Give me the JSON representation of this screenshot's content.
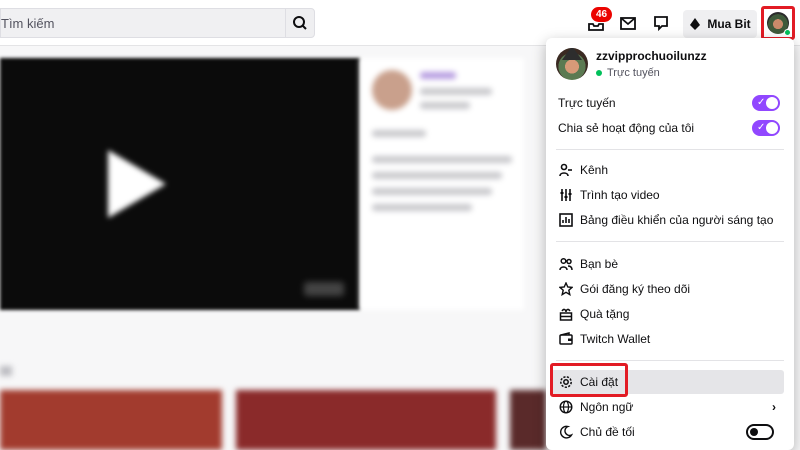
{
  "search": {
    "placeholder": "Tìm kiếm"
  },
  "header": {
    "notification_count": "46",
    "bits_label": "Mua Bit"
  },
  "menu": {
    "username": "zzvipprochuoilunzz",
    "status": "Trực tuyến",
    "toggles": [
      {
        "label": "Trực tuyến",
        "on": true
      },
      {
        "label": "Chia sẻ hoạt động của tôi",
        "on": true
      }
    ],
    "group1": [
      {
        "label": "Kênh",
        "icon": "channel-icon"
      },
      {
        "label": "Trình tạo video",
        "icon": "video-producer-icon"
      },
      {
        "label": "Bảng điều khiển của người sáng tạo",
        "icon": "creator-dashboard-icon"
      }
    ],
    "group2": [
      {
        "label": "Bạn bè",
        "icon": "friends-icon"
      },
      {
        "label": "Gói đăng ký theo dõi",
        "icon": "star-icon"
      },
      {
        "label": "Quà tặng",
        "icon": "gift-icon"
      },
      {
        "label": "Twitch Wallet",
        "icon": "wallet-icon"
      }
    ],
    "group3": [
      {
        "label": "Cài đặt",
        "icon": "settings-icon"
      },
      {
        "label": "Ngôn ngữ",
        "icon": "globe-icon"
      },
      {
        "label": "Chủ đề tối",
        "icon": "moon-icon",
        "on": false
      }
    ]
  },
  "colors": {
    "accent": "#9147ff",
    "highlight": "#e21b24",
    "online": "#00c05a"
  }
}
